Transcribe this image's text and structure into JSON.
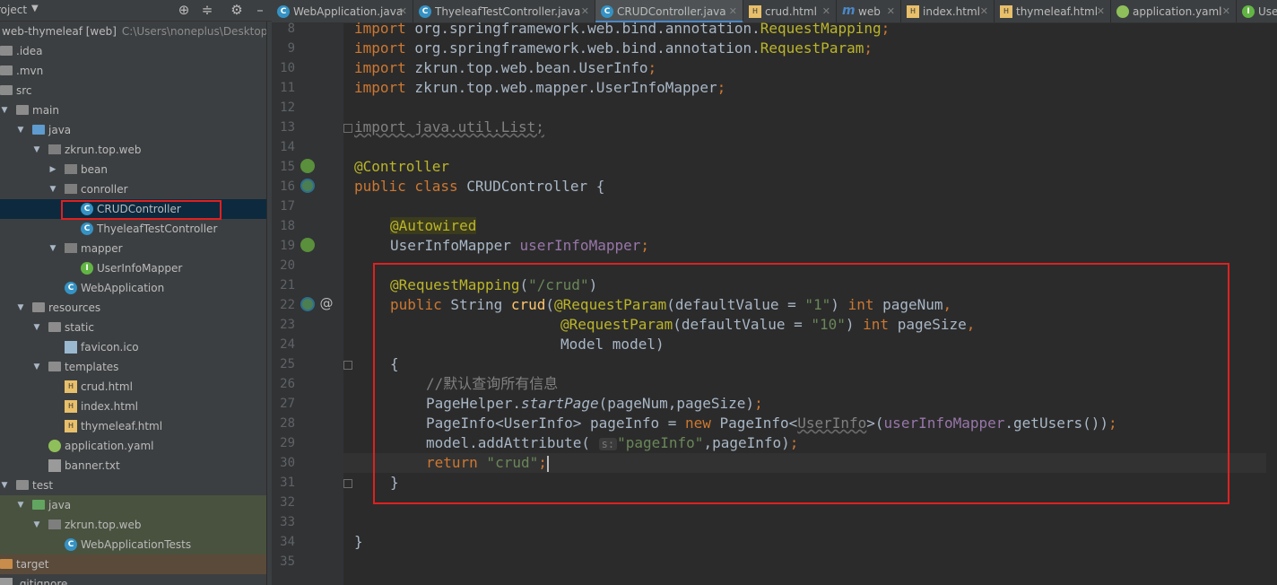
{
  "project_panel": {
    "title": "roject",
    "tree": [
      {
        "label": "web-thymeleaf [web]",
        "sub": "C:\\Users\\noneplus\\Desktop\\web-"
      },
      {
        "label": ".idea"
      },
      {
        "label": ".mvn"
      },
      {
        "label": "src"
      },
      {
        "label": "main"
      },
      {
        "label": "java"
      },
      {
        "label": "zkrun.top.web"
      },
      {
        "label": "bean"
      },
      {
        "label": "conroller"
      },
      {
        "label": "CRUDController"
      },
      {
        "label": "ThyeleafTestController"
      },
      {
        "label": "mapper"
      },
      {
        "label": "UserInfoMapper"
      },
      {
        "label": "WebApplication"
      },
      {
        "label": "resources"
      },
      {
        "label": "static"
      },
      {
        "label": "favicon.ico"
      },
      {
        "label": "templates"
      },
      {
        "label": "crud.html"
      },
      {
        "label": "index.html"
      },
      {
        "label": "thymeleaf.html"
      },
      {
        "label": "application.yaml"
      },
      {
        "label": "banner.txt"
      },
      {
        "label": "test"
      },
      {
        "label": "java"
      },
      {
        "label": "zkrun.top.web"
      },
      {
        "label": "WebApplicationTests"
      },
      {
        "label": "target"
      },
      {
        "label": ".gitignore"
      }
    ]
  },
  "tabs": [
    {
      "label": "WebApplication.java"
    },
    {
      "label": "ThyeleafTestController.java"
    },
    {
      "label": "CRUDController.java"
    },
    {
      "label": "crud.html"
    },
    {
      "label": "web"
    },
    {
      "label": "index.html"
    },
    {
      "label": "thymeleaf.html"
    },
    {
      "label": "application.yaml"
    },
    {
      "label": "Use"
    }
  ],
  "editor": {
    "line_numbers": [
      "8",
      "9",
      "10",
      "11",
      "12",
      "13",
      "14",
      "15",
      "16",
      "17",
      "18",
      "19",
      "20",
      "21",
      "22",
      "23",
      "24",
      "25",
      "26",
      "27",
      "28",
      "29",
      "30",
      "31",
      "32",
      "33",
      "34",
      "35"
    ],
    "code": {
      "l8_kw": "import",
      "l8_a": " org.springframework.web.bind.annotation.",
      "l8_b": "RequestMapping",
      "l8_c": ";",
      "l9_kw": "import",
      "l9_a": " org.springframework.web.bind.annotation.",
      "l9_b": "RequestParam",
      "l9_c": ";",
      "l10_kw": "import",
      "l10_a": " zkrun.top.web.bean.UserInfo",
      "l10_c": ";",
      "l11_kw": "import",
      "l11_a": " zkrun.top.web.mapper.UserInfoMapper",
      "l11_c": ";",
      "l13": "import java.util.List;",
      "l15": "@Controller",
      "l16_kw": "public class",
      "l16_a": " CRUDController {",
      "l18": "@Autowired",
      "l19_a": "UserInfoMapper ",
      "l19_f": "userInfoMapper",
      "l19_c": ";",
      "l21_ann": "@RequestMapping",
      "l21_a": "(",
      "l21_str": "\"/crud\"",
      "l21_b": ")",
      "l22_kw": "public",
      "l22_a": " String ",
      "l22_m": "crud",
      "l22_b": "(",
      "l22_ann": "@RequestParam",
      "l22_c": "(defaultValue = ",
      "l22_str": "\"1\"",
      "l22_d": ") ",
      "l22_kw2": "int",
      "l22_e": " pageNum",
      "l22_f": ",",
      "l23_ann": "@RequestParam",
      "l23_c": "(defaultValue = ",
      "l23_str": "\"10\"",
      "l23_d": ") ",
      "l23_kw2": "int",
      "l23_e": " pageSize",
      "l23_f": ",",
      "l24": "Model model)",
      "l25": "{",
      "l26": "//默认查询所有信息",
      "l27_a": "PageHelper.",
      "l27_i": "startPage",
      "l27_b": "(pageNum,pageSize)",
      "l27_c": ";",
      "l28_a": "PageInfo<UserInfo> pageInfo = ",
      "l28_kw": "new",
      "l28_b": " PageInfo<",
      "l28_u": "UserInfo",
      "l28_c": ">(",
      "l28_f": "userInfoMapper",
      "l28_d": ".getUsers())",
      "l28_e": ";",
      "l29_a": "model.addAttribute( ",
      "l29_hint": "s:",
      "l29_str": "\"pageInfo\"",
      "l29_b": ",pageInfo)",
      "l29_c": ";",
      "l30_kw": "return",
      "l30_str": " \"crud\"",
      "l30_c": ";",
      "l31": "}",
      "l34": "}"
    }
  },
  "colors": {
    "keyword": "#cc7832",
    "annotation": "#bbb529",
    "string": "#6a8759",
    "comment": "#808080",
    "field": "#9876aa",
    "highlight_box": "#e02020"
  }
}
